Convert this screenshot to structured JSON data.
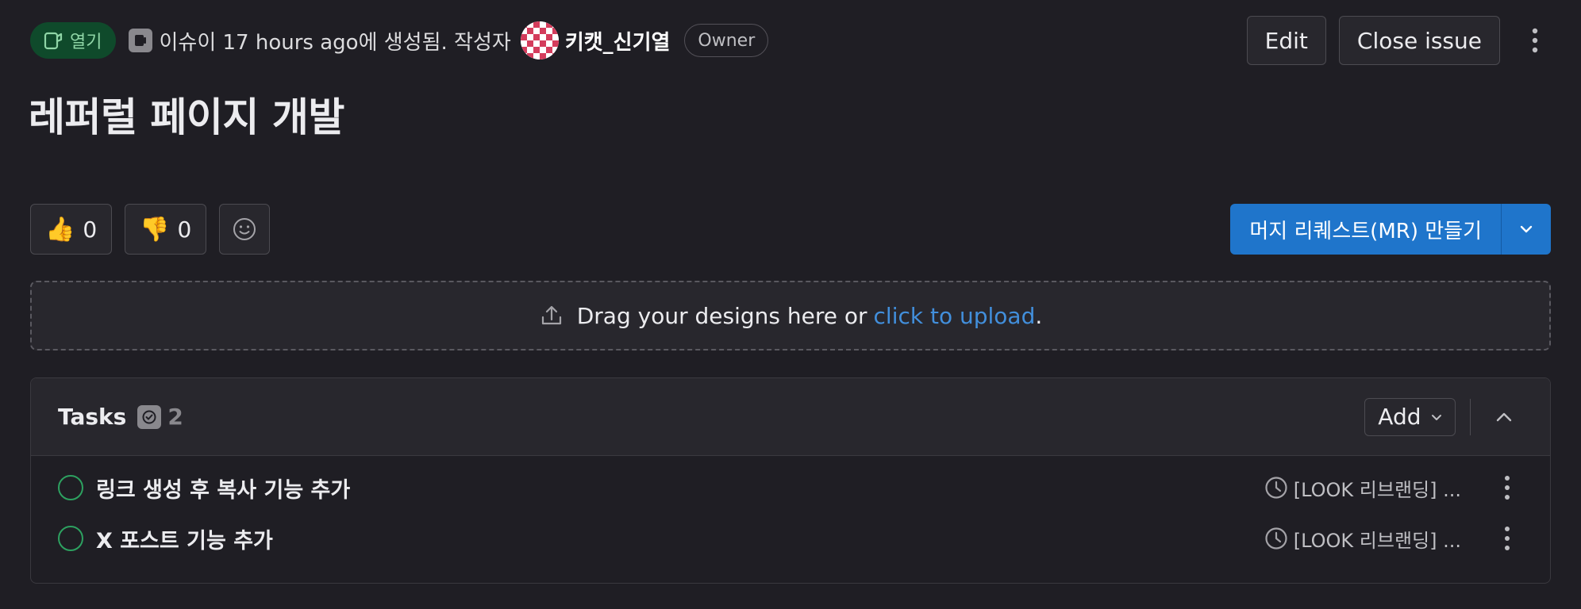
{
  "header": {
    "status": "열기",
    "created_text": "이슈이 17 hours ago에 생성됨. 작성자",
    "author": "키캣_신기열",
    "role_badge": "Owner",
    "edit_label": "Edit",
    "close_label": "Close issue"
  },
  "issue": {
    "title": "레퍼럴 페이지 개발"
  },
  "reactions": [
    {
      "emoji": "👍",
      "count": "0"
    },
    {
      "emoji": "👎",
      "count": "0"
    }
  ],
  "merge_request": {
    "label": "머지 리퀘스트(MR) 만들기"
  },
  "upload": {
    "text": "Drag your designs here or",
    "link": "click to upload",
    "suffix": "."
  },
  "tasks": {
    "title": "Tasks",
    "count": "2",
    "add_label": "Add",
    "items": [
      {
        "title": "링크 생성 후 복사 기능 추가",
        "milestone": "[LOOK 리브랜딩] ..."
      },
      {
        "title": "X 포스트 기능 추가",
        "milestone": "[LOOK 리브랜딩] ..."
      }
    ]
  },
  "colors": {
    "background": "#1f1e24",
    "primary": "#1f75cb",
    "open_badge": "#0f4a2b",
    "link": "#428fdc",
    "task_open": "#2da160"
  },
  "icons": [
    "issue-open-icon",
    "issue-type-icon",
    "kebab-icon",
    "smiley-icon",
    "chevron-down-icon",
    "upload-icon",
    "task-done-icon",
    "chevron-up-icon",
    "clock-icon"
  ]
}
